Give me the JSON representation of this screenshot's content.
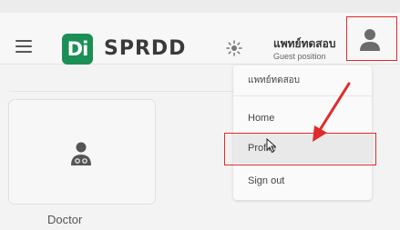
{
  "header": {
    "brand_logo_text": "Di",
    "brand_name": "SPRDD",
    "user_name": "แพทย์ทดสอบ",
    "user_role": "Guest position"
  },
  "icons": {
    "menu": "hamburger-menu-icon",
    "theme": "sun-icon",
    "avatar": "person-icon",
    "doctor": "doctor-icon"
  },
  "card": {
    "label": "Doctor"
  },
  "user_menu": {
    "header": "แพทย์ทดสอบ",
    "items": [
      "Home",
      "Profile",
      "Sign out"
    ]
  },
  "colors": {
    "brand": "#1b8f55",
    "annotation": "#e02b2b"
  }
}
